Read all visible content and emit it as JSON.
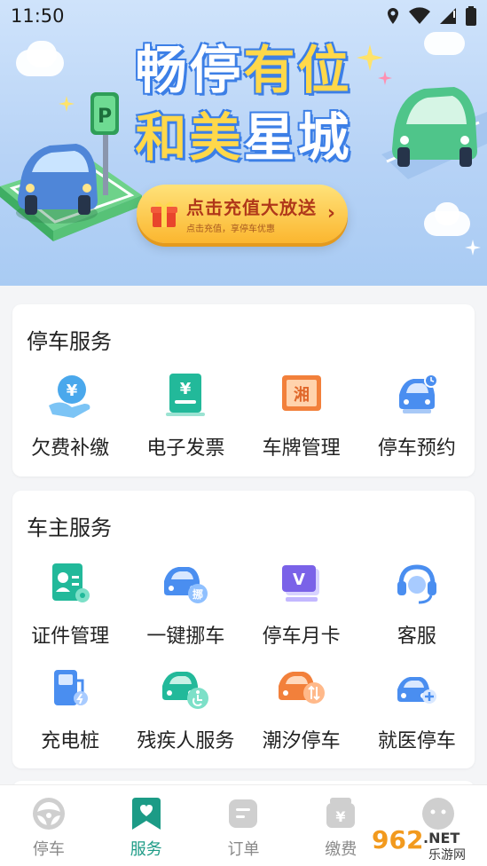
{
  "status_bar": {
    "time": "11:50"
  },
  "banner": {
    "headline_line1_a": "畅停",
    "headline_line1_b": "有位",
    "headline_line2_a": "和美",
    "headline_line2_b": "星城",
    "parking_sign": "P",
    "promo_title": "点击充值大放送",
    "promo_subtitle": "点击充值，享停车优惠"
  },
  "parking_services": {
    "title": "停车服务",
    "items": [
      {
        "label": "欠费补缴",
        "icon": "arrears-payment-icon"
      },
      {
        "label": "电子发票",
        "icon": "e-invoice-icon"
      },
      {
        "label": "车牌管理",
        "icon": "plate-management-icon"
      },
      {
        "label": "停车预约",
        "icon": "parking-reservation-icon"
      }
    ]
  },
  "owner_services": {
    "title": "车主服务",
    "items": [
      {
        "label": "证件管理",
        "icon": "document-management-icon"
      },
      {
        "label": "一键挪车",
        "icon": "move-car-icon",
        "badge": "挪"
      },
      {
        "label": "停车月卡",
        "icon": "monthly-card-icon",
        "badge": "V"
      },
      {
        "label": "客服",
        "icon": "customer-service-icon"
      },
      {
        "label": "充电桩",
        "icon": "charging-pile-icon"
      },
      {
        "label": "残疾人服务",
        "icon": "disabled-service-icon"
      },
      {
        "label": "潮汐停车",
        "icon": "tidal-parking-icon"
      },
      {
        "label": "就医停车",
        "icon": "hospital-parking-icon"
      }
    ]
  },
  "bottom_nav": [
    {
      "label": "停车",
      "icon": "steering-wheel-icon",
      "active": false
    },
    {
      "label": "服务",
      "icon": "service-bookmark-icon",
      "active": true
    },
    {
      "label": "订单",
      "icon": "order-icon",
      "active": false
    },
    {
      "label": "缴费",
      "icon": "payment-icon",
      "active": false
    },
    {
      "label": "",
      "icon": "profile-icon",
      "active": false
    }
  ],
  "watermark": {
    "text_a": "962",
    "text_b": ".NET",
    "text_c": "乐游网"
  },
  "colors": {
    "accent": "#1c9b86",
    "banner_blue": "#3c7fe6",
    "promo_yellow": "#fbb62f"
  }
}
